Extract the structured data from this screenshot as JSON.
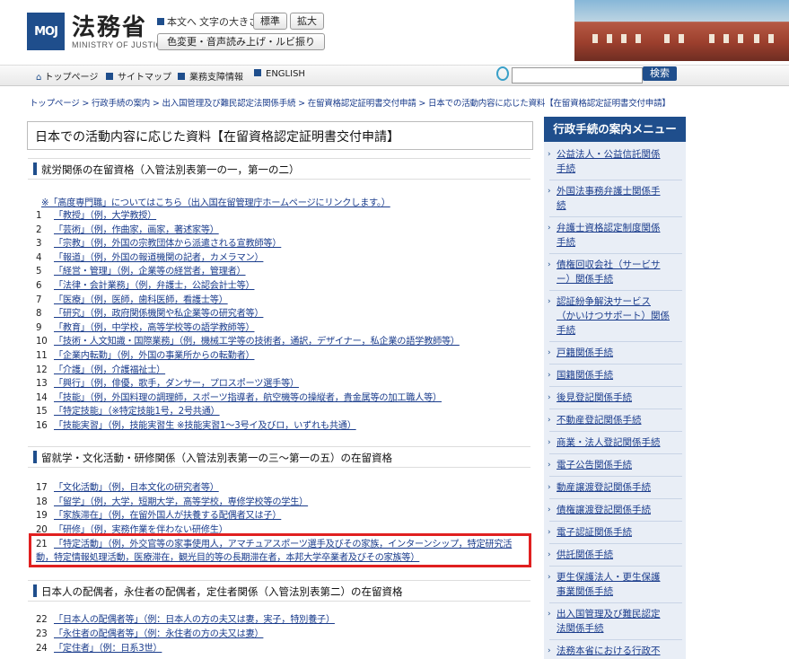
{
  "header": {
    "logo_text": "MOJ",
    "site_name": "法務省",
    "site_sub": "MINISTRY OF JUSTICE",
    "skip_link": "本文へ",
    "font_size_label": "文字の大きさ",
    "font_standard": "標準",
    "font_large": "拡大",
    "color_tools": "色変更・音声読み上げ・ルビ振り"
  },
  "nav": {
    "items": [
      "トップページ",
      "サイトマップ",
      "業務支障情報",
      "ENGLISH"
    ],
    "search_placeholder": "",
    "search_button": "検索"
  },
  "breadcrumb": "トップページ > 行政手続の案内 > 出入国管理及び難民認定法関係手続 > 在留資格認定証明書交付申請 > 日本での活動内容に応じた資料【在留資格認定証明書交付申請】",
  "page_title": "日本での活動内容に応じた資料【在留資格認定証明書交付申請】",
  "sections": [
    {
      "title": "就労関係の在留資格（入管法別表第一の一，第一の二）"
    },
    {
      "title": "留就学・文化活動・研修関係（入管法別表第一の三～第一の五）の在留資格"
    },
    {
      "title": "日本人の配偶者，永住者の配偶者，定住者関係（入管法別表第二）の在留資格"
    }
  ],
  "note": "※「高度専門職」についてはこちら（出入国在留管理庁ホームページにリンクします。）",
  "work_items": [
    {
      "n": "1",
      "t": "「教授」（例，大学教授）"
    },
    {
      "n": "2",
      "t": "「芸術」（例，作曲家，画家，著述家等）"
    },
    {
      "n": "3",
      "t": "「宗教」（例，外国の宗教団体から派遣される宣教師等）"
    },
    {
      "n": "4",
      "t": "「報道」（例，外国の報道機関の記者，カメラマン）"
    },
    {
      "n": "5",
      "t": "「経営・管理」（例，企業等の経営者，管理者）"
    },
    {
      "n": "6",
      "t": "「法律・会計業務」（例，弁護士，公認会計士等）"
    },
    {
      "n": "7",
      "t": "「医療」（例，医師，歯科医師，看護士等）"
    },
    {
      "n": "8",
      "t": "「研究」（例，政府関係機関や私企業等の研究者等）"
    },
    {
      "n": "9",
      "t": "「教育」（例，中学校，高等学校等の語学教師等）"
    },
    {
      "n": "10",
      "t": "「技術・人文知識・国際業務」（例，機械工学等の技術者，通訳，デザイナー，私企業の語学教師等）"
    },
    {
      "n": "11",
      "t": "「企業内転勤」（例，外国の事業所からの転勤者）"
    },
    {
      "n": "12",
      "t": "「介護」（例，介護福祉士）"
    },
    {
      "n": "13",
      "t": "「興行」（例，俳優，歌手，ダンサー，プロスポーツ選手等）"
    },
    {
      "n": "14",
      "t": "「技能」（例，外国料理の調理師，スポーツ指導者，航空機等の操縦者，貴金属等の加工職人等）"
    },
    {
      "n": "15",
      "t": "「特定技能」（※特定技能1号，2号共通）"
    },
    {
      "n": "16",
      "t": "「技能実習」（例，技能実習生 ※技能実習1～3号イ及びロ，いずれも共通）"
    }
  ],
  "study_items": [
    {
      "n": "17",
      "t": "「文化活動」（例，日本文化の研究者等）"
    },
    {
      "n": "18",
      "t": "「留学」（例，大学，短期大学，高等学校，専修学校等の学生）"
    },
    {
      "n": "19",
      "t": "「家族滞在」（例，在留外国人が扶養する配偶者又は子）"
    },
    {
      "n": "20",
      "t": "「研修」（例，実務作業を伴わない研修生）"
    },
    {
      "n": "21",
      "t": "「特定活動」（例，外交官等の家事使用人，アマチュアスポーツ選手及びその家族，インターンシップ，特定研究活"
    },
    {
      "n": "",
      "t": "動，特定情報処理活動，医療滞在，観光目的等の長期滞在者，本邦大学卒業者及びその家族等）"
    }
  ],
  "spouse_items": [
    {
      "n": "22",
      "t": "「日本人の配偶者等」（例：日本人の方の夫又は妻，実子，特別養子）"
    },
    {
      "n": "23",
      "t": "「永住者の配偶者等」（例：永住者の方の夫又は妻）"
    },
    {
      "n": "24",
      "t": "「定住者」（例：日系3世）"
    }
  ],
  "sidebar": {
    "title": "行政手続の案内メニュー",
    "items": [
      [
        "公益法人・公益信託関係",
        "手続"
      ],
      [
        "外国法事務弁護士関係手",
        "続"
      ],
      [
        "弁護士資格認定制度関係",
        "手続"
      ],
      [
        "債権回収会社（サービサ",
        "ー）関係手続"
      ],
      [
        "認証紛争解決サービス",
        "（かいけつサポート）関係",
        "手続"
      ],
      [
        "戸籍関係手続"
      ],
      [
        "国籍関係手続"
      ],
      [
        "後見登記関係手続"
      ],
      [
        "不動産登記関係手続"
      ],
      [
        "商業・法人登記関係手続"
      ],
      [
        "電子公告関係手続"
      ],
      [
        "動産譲渡登記関係手続"
      ],
      [
        "債権譲渡登記関係手続"
      ],
      [
        "電子認証関係手続"
      ],
      [
        "供託関係手続"
      ],
      [
        "更生保護法人・更生保護",
        "事業関係手続"
      ],
      [
        "出入国管理及び難民認定",
        "法関係手続"
      ],
      [
        "法務本省における行政不"
      ]
    ]
  }
}
